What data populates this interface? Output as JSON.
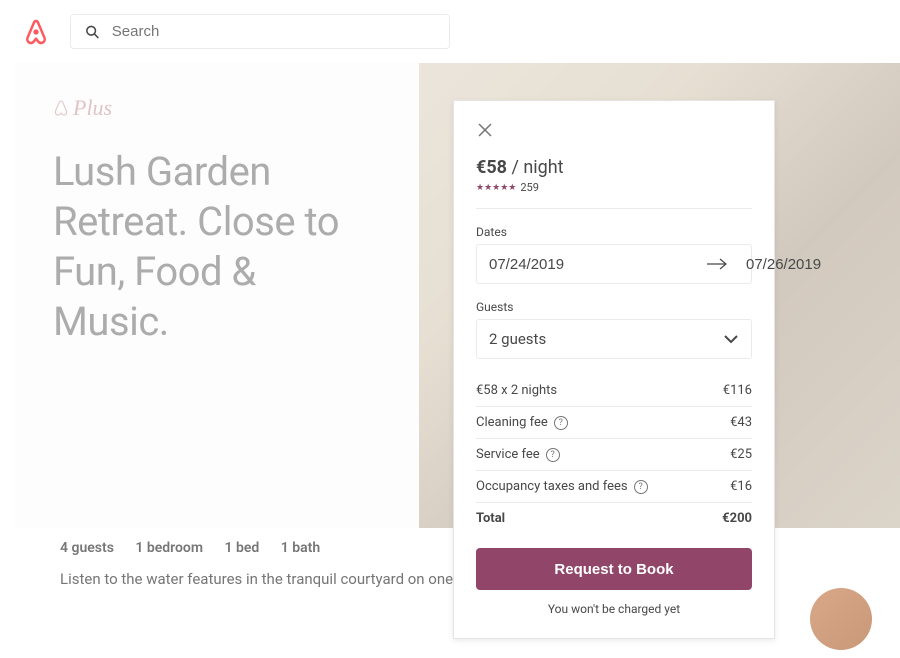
{
  "header": {
    "search_placeholder": "Search"
  },
  "listing": {
    "badge": "Plus",
    "title": "Lush Garden Retreat. Close to Fun, Food & Music.",
    "guests": "4 guests",
    "bedrooms": "1 bedroom",
    "beds": "1 bed",
    "baths": "1 bath",
    "description": "Listen to the water features in the tranquil courtyard on one of the most beautiful"
  },
  "booking": {
    "price": "€58",
    "per_unit": "/ night",
    "review_count": "259",
    "dates_label": "Dates",
    "checkin": "07/24/2019",
    "checkout": "07/26/2019",
    "guests_label": "Guests",
    "guests_value": "2 guests",
    "lines": [
      {
        "label": "€58 x 2 nights",
        "amount": "€116",
        "help": false
      },
      {
        "label": "Cleaning fee",
        "amount": "€43",
        "help": true
      },
      {
        "label": "Service fee",
        "amount": "€25",
        "help": true
      },
      {
        "label": "Occupancy taxes and fees",
        "amount": "€16",
        "help": true
      }
    ],
    "total_label": "Total",
    "total_amount": "€200",
    "cta": "Request to Book",
    "disclaimer": "You won't be charged yet"
  },
  "colors": {
    "brand": "#FF5A5F",
    "accent": "#914669",
    "text": "#484848"
  }
}
